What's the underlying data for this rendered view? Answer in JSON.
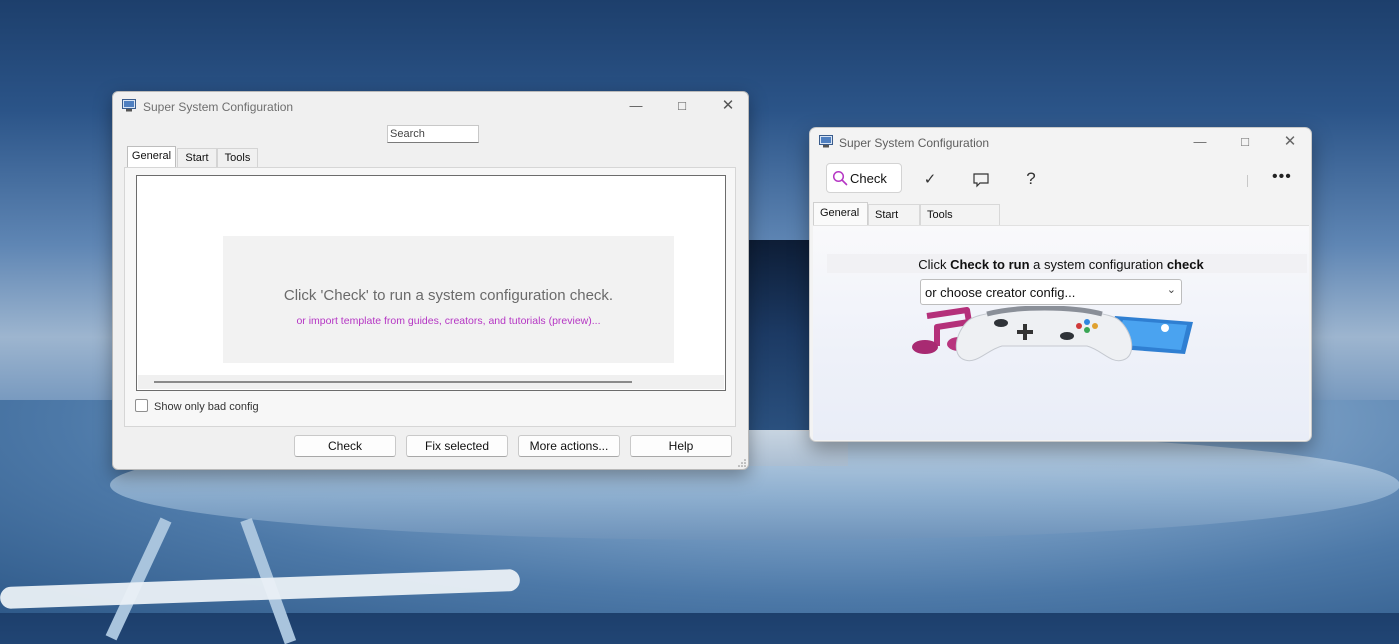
{
  "desktop": {
    "background": "#2b5488"
  },
  "classic_window": {
    "title": "Super System Configuration",
    "search_placeholder": "Search",
    "tabs": [
      "General",
      "Start",
      "Tools"
    ],
    "active_tab": "General",
    "placeholder_main": "Click 'Check' to run a system configuration check.",
    "placeholder_link": "or import template from guides, creators, and tutorials (preview)...",
    "checkbox_label": "Show only bad config",
    "checkbox_checked": false,
    "buttons": {
      "check": "Check",
      "fix": "Fix selected",
      "more": "More actions...",
      "help": "Help"
    },
    "link_color": "#b536c4"
  },
  "modern_window": {
    "title": "Super System Configuration",
    "toolbar": {
      "check_label": "Check",
      "accent": "#b536c4"
    },
    "tabs": [
      "General",
      "Start",
      "Tools"
    ],
    "active_tab": "General",
    "headline": {
      "part1": "Click ",
      "bold1": "Check to run",
      "part2": " a system configuration ",
      "bold2": "check"
    },
    "select_value": "or choose creator config..."
  }
}
